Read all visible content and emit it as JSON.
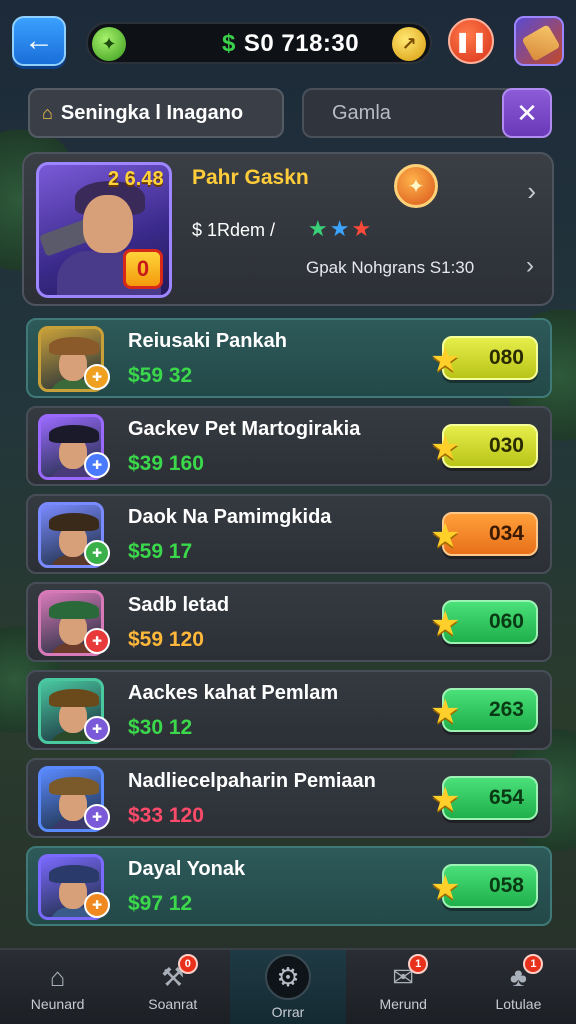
{
  "header": {
    "back_icon": "arrow-left-icon",
    "cash_symbol": "$",
    "cash_amount": "S0 718:30",
    "pause_icon": "pause-icon"
  },
  "search": {
    "filter_label": "Seningka l Inagano",
    "placeholder": "Gamla",
    "clear_icon": "close-icon"
  },
  "featured": {
    "price": "2 6.48",
    "title": "Pahr Gaskn",
    "badge_text": "0",
    "subtitle": "$ 1Rdem /",
    "description": "Gpak Nohgrans S1:30"
  },
  "items": [
    {
      "name": "Reiusaki Pankah",
      "price": "$59 32",
      "price_color": "#3ad84a",
      "button": "080",
      "button_style": "yellow",
      "row_style": "teal",
      "frame": "#c8a03a",
      "hat": "#8a5a2a",
      "body": "#3a6a3a",
      "badge_color": "#f0a020"
    },
    {
      "name": "Gackev Pet Martogirakia",
      "price": "$39 160",
      "price_color": "#3ad84a",
      "button": "030",
      "button_style": "yellow",
      "row_style": "dark",
      "frame": "#9a6aff",
      "hat": "#1a1a2a",
      "body": "#4a3a7a",
      "badge_color": "#4a7aff"
    },
    {
      "name": "Daok Na Pamimgkida",
      "price": "$59 17",
      "price_color": "#3ad84a",
      "button": "034",
      "button_style": "orange",
      "row_style": "dark",
      "frame": "#7a8aff",
      "hat": "#3a2a1a",
      "body": "#5a3a2a",
      "badge_color": "#3ab04a"
    },
    {
      "name": "Sadb letad",
      "price": "$59 120",
      "price_color": "#ffb83a",
      "button": "060",
      "button_style": "green",
      "row_style": "dark",
      "frame": "#d87ab8",
      "hat": "#2a6a3a",
      "body": "#6a3a2a",
      "badge_color": "#e83a3a"
    },
    {
      "name": "Aackes kahat Pemlam",
      "price": "$30 12",
      "price_color": "#3ad84a",
      "button": "263",
      "button_style": "green",
      "row_style": "dark",
      "frame": "#4ac8a0",
      "hat": "#6a4a1a",
      "body": "#2a4a2a",
      "badge_color": "#7a5ad8"
    },
    {
      "name": "Nadliecelpaharin Pemiaan",
      "price": "$33 120",
      "price_color": "#ff4a6a",
      "button": "654",
      "button_style": "green",
      "row_style": "dark",
      "frame": "#5a8aff",
      "hat": "#7a5a2a",
      "body": "#3a3a6a",
      "badge_color": "#7a5ad8"
    },
    {
      "name": "Dayal Yonak",
      "price": "$97 12",
      "price_color": "#3ad84a",
      "button": "058",
      "button_style": "green",
      "row_style": "teal",
      "frame": "#7a6aff",
      "hat": "#2a3a6a",
      "body": "#3a5a8a",
      "badge_color": "#f08a20"
    }
  ],
  "nav": [
    {
      "label": "Neunard",
      "icon": "home-icon",
      "badge": ""
    },
    {
      "label": "Soanrat",
      "icon": "crafting-icon",
      "badge": "0"
    },
    {
      "label": "Orrar",
      "icon": "gear-icon",
      "badge": "",
      "active": true
    },
    {
      "label": "Merund",
      "icon": "mail-icon",
      "badge": "1"
    },
    {
      "label": "Lotulae",
      "icon": "team-icon",
      "badge": "1"
    }
  ]
}
